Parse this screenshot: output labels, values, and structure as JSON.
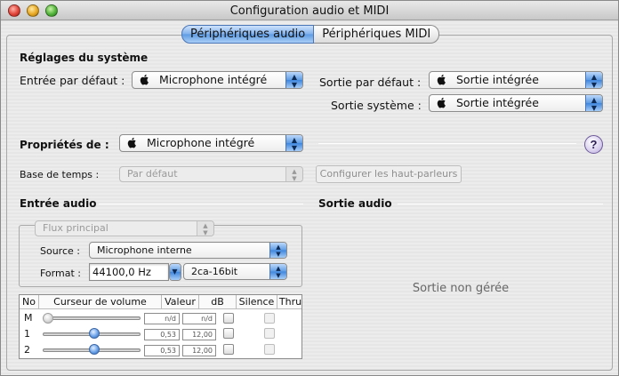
{
  "window": {
    "title": "Configuration audio et MIDI"
  },
  "tabs": [
    {
      "label": "Périphériques audio",
      "active": true
    },
    {
      "label": "Périphériques MIDI",
      "active": false
    }
  ],
  "system_settings": {
    "heading": "Réglages du système",
    "default_input_label": "Entrée par défaut :",
    "default_input_value": "Microphone intégré",
    "default_output_label": "Sortie par défaut :",
    "default_output_value": "Sortie intégrée",
    "system_output_label": "Sortie système :",
    "system_output_value": "Sortie intégrée"
  },
  "properties": {
    "label": "Propriétés de :",
    "value": "Microphone intégré",
    "help": "?"
  },
  "clock": {
    "label": "Base de temps :",
    "value": "Par défaut",
    "configure_button": "Configurer les haut-parleurs"
  },
  "audio_input": {
    "heading": "Entrée audio",
    "stream_value": "Flux principal",
    "source_label": "Source :",
    "source_value": "Microphone interne",
    "format_label": "Format :",
    "format_rate": "44100,0 Hz",
    "format_bits": "2ca-16bit",
    "table": {
      "headers": [
        "No",
        "Curseur de volume",
        "Valeur",
        "dB",
        "Silence",
        "Thru"
      ],
      "rows": [
        {
          "no": "M",
          "valeur": "n/d",
          "db": "n/d",
          "slider": 0.0
        },
        {
          "no": "1",
          "valeur": "0,53",
          "db": "12,00",
          "slider": 0.53
        },
        {
          "no": "2",
          "valeur": "0,53",
          "db": "12,00",
          "slider": 0.53
        }
      ]
    }
  },
  "audio_output": {
    "heading": "Sortie audio",
    "status": "Sortie non gérée"
  },
  "colors": {
    "accent": "#5d9be3",
    "help_button": "#d9d0ee"
  },
  "icons": {
    "apple": "apple-icon",
    "popup_arrows": "updown-arrows-icon"
  }
}
